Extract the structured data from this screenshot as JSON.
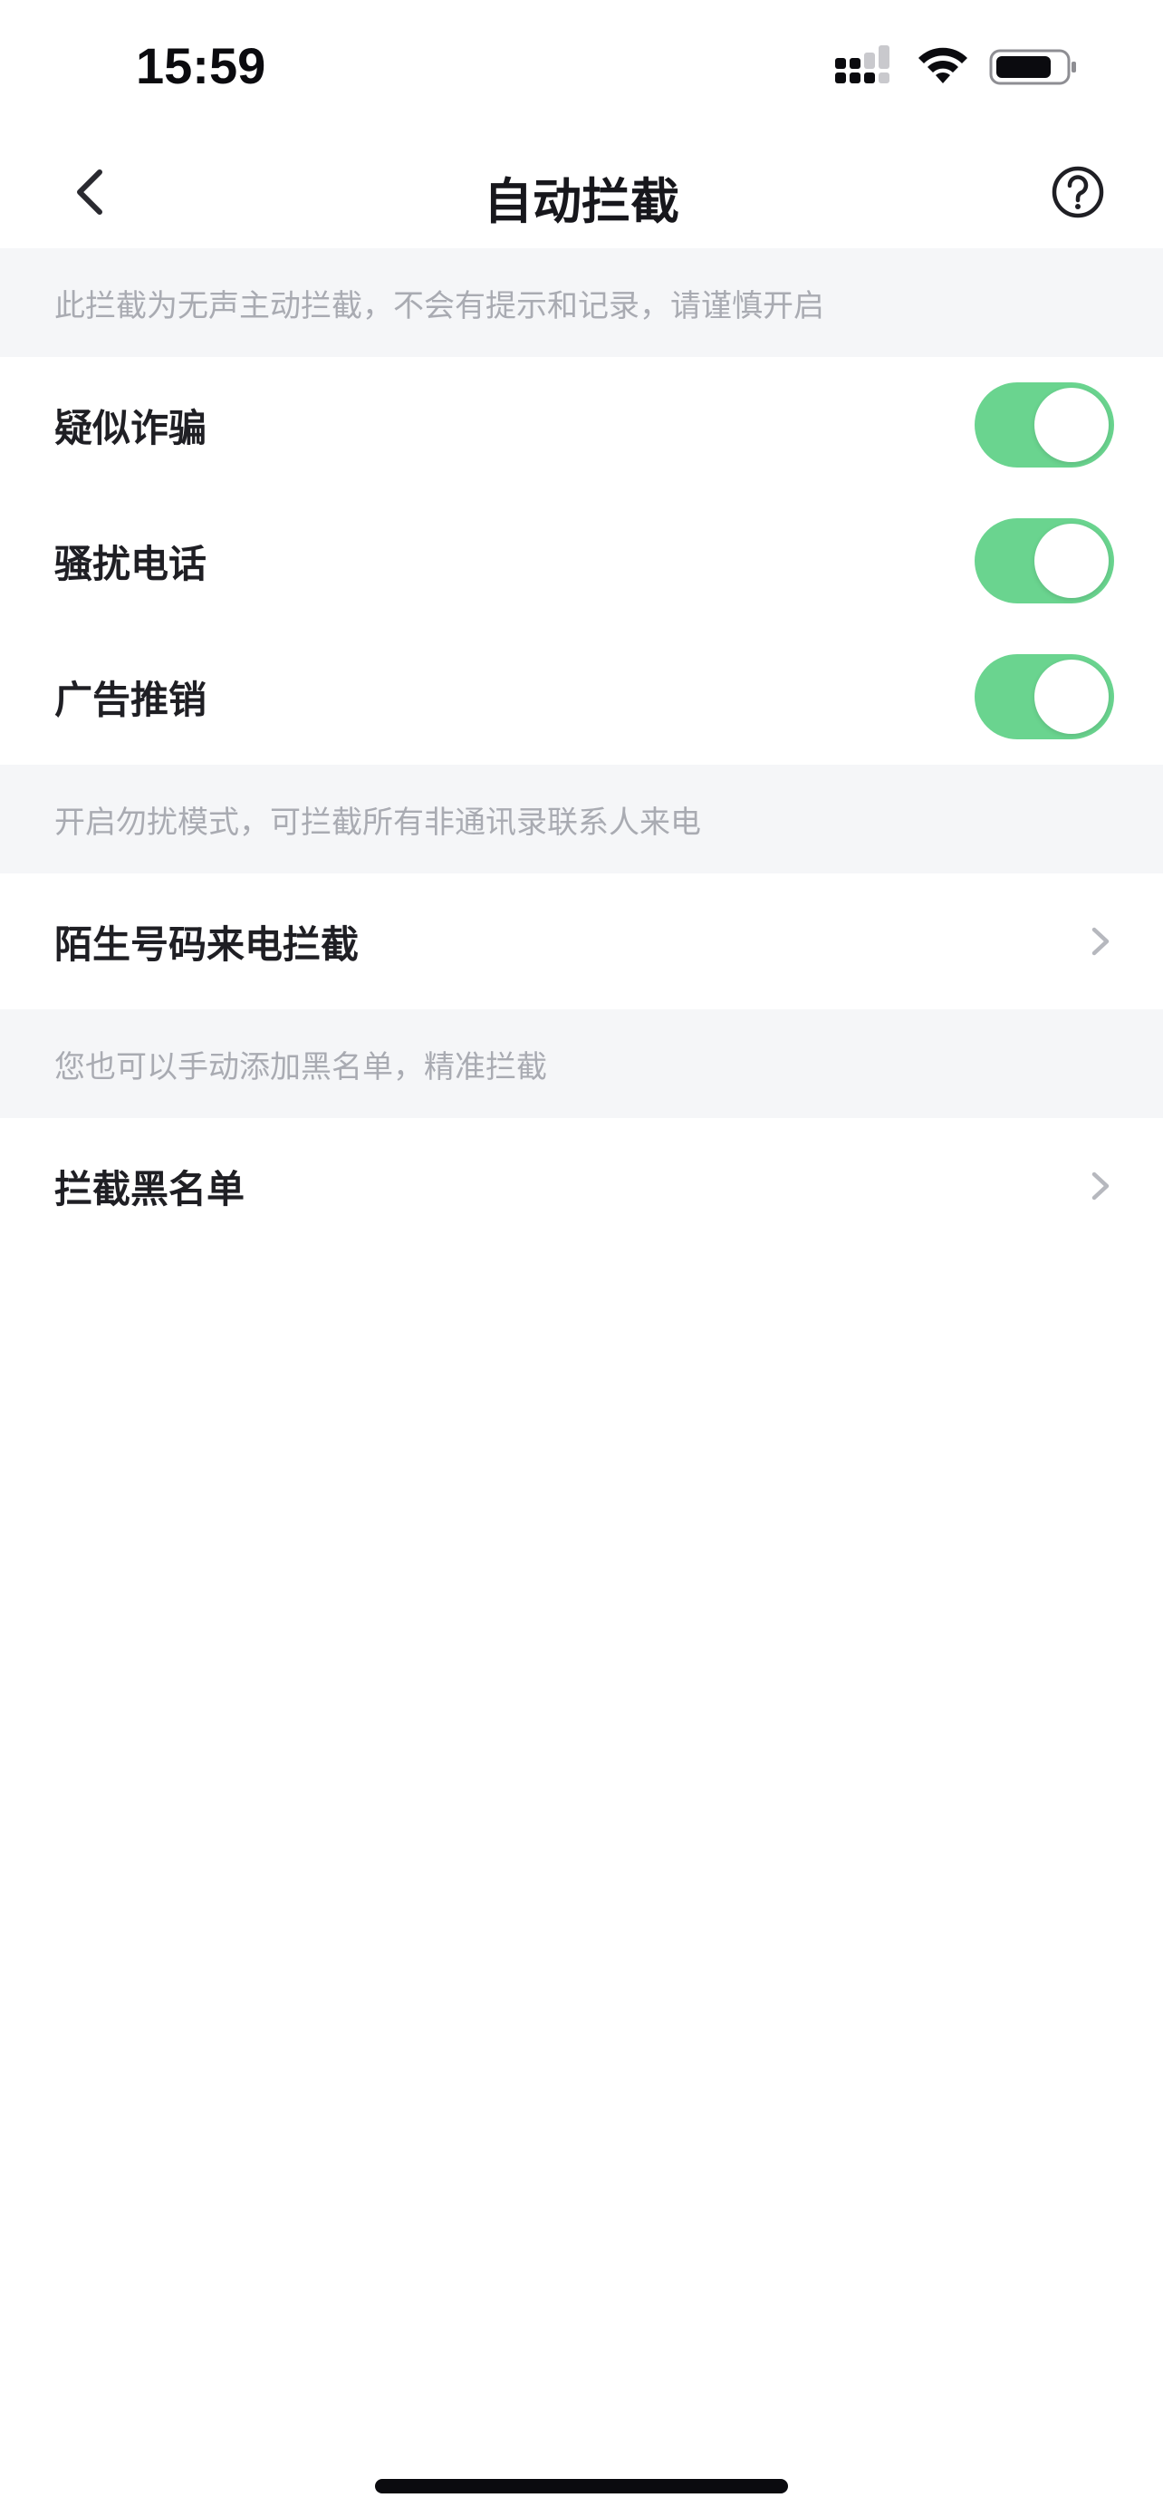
{
  "status_bar": {
    "time": "15:59"
  },
  "nav": {
    "title": "自动拦截"
  },
  "sections": {
    "auto_note": "此拦截为无声主动拦截，不会有提示和记录，请谨慎开启",
    "auto_items": [
      {
        "label": "疑似诈骗",
        "enabled": true
      },
      {
        "label": "骚扰电话",
        "enabled": true
      },
      {
        "label": "广告推销",
        "enabled": true
      }
    ],
    "dnd_note": "开启勿扰模式，可拦截所有非通讯录联系人来电",
    "stranger_row": {
      "label": "陌生号码来电拦截"
    },
    "blacklist_note": "您也可以手动添加黑名单，精准拦截",
    "blacklist_row": {
      "label": "拦截黑名单"
    }
  },
  "colors": {
    "toggle_on": "#6ad48f",
    "note_bg": "#f5f6f8",
    "note_text": "#a9abb2"
  },
  "icons": {
    "back": "chevron-left-icon",
    "help": "question-circle-icon",
    "row_arrow": "chevron-right-icon"
  }
}
